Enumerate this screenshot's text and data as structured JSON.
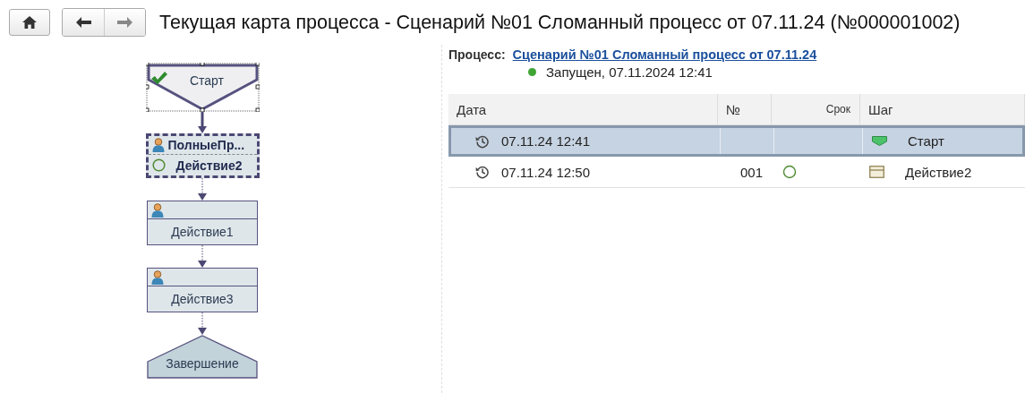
{
  "window": {
    "title": "Текущая карта процесса - Сценарий №01 Сломанный процесс от 07.11.24 (№000001002)"
  },
  "diagram": {
    "nodes": [
      {
        "kind": "start",
        "label": "Старт",
        "completed": true,
        "selected": true,
        "outgoing_passed": true
      },
      {
        "kind": "action",
        "performer": "ПолныеПр...",
        "label": "Действие2",
        "current": true,
        "outgoing_passed": false
      },
      {
        "kind": "action",
        "label": "Действие1",
        "current": false,
        "outgoing_passed": false
      },
      {
        "kind": "action",
        "label": "Действие3",
        "current": false,
        "outgoing_passed": false
      },
      {
        "kind": "end",
        "label": "Завершение"
      }
    ]
  },
  "process": {
    "label": "Процесс:",
    "link": "Сценарий №01 Сломанный процесс от 07.11.24",
    "status": "Запущен, 07.11.2024 12:41"
  },
  "table": {
    "columns": [
      "Дата",
      "№",
      "Срок",
      "Шаг"
    ],
    "rows": [
      {
        "date": "07.11.24 12:41",
        "in_progress": false,
        "step": {
          "kind": "start",
          "label": "Старт"
        },
        "selected": true
      },
      {
        "date": "07.11.24 12:50",
        "number": "001",
        "in_progress": true,
        "step": {
          "kind": "action",
          "label": "Действие2"
        },
        "selected": false
      }
    ]
  }
}
